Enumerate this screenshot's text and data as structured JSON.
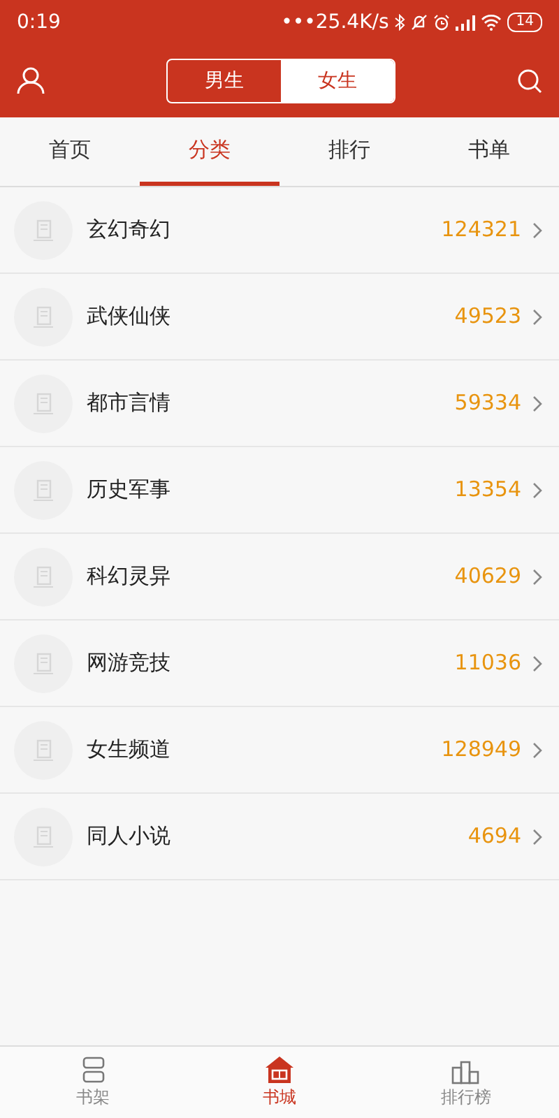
{
  "status_bar": {
    "time": "0:19",
    "network_speed": "•••25.4K/s",
    "battery": "14"
  },
  "header": {
    "segments": [
      {
        "label": "男生",
        "selected": false
      },
      {
        "label": "女生",
        "selected": true
      }
    ]
  },
  "tabs": [
    {
      "label": "首页",
      "selected": false
    },
    {
      "label": "分类",
      "selected": true
    },
    {
      "label": "排行",
      "selected": false
    },
    {
      "label": "书单",
      "selected": false
    }
  ],
  "categories": [
    {
      "name": "玄幻奇幻",
      "count": "124321"
    },
    {
      "name": "武侠仙侠",
      "count": "49523"
    },
    {
      "name": "都市言情",
      "count": "59334"
    },
    {
      "name": "历史军事",
      "count": "13354"
    },
    {
      "name": "科幻灵异",
      "count": "40629"
    },
    {
      "name": "网游竞技",
      "count": "11036"
    },
    {
      "name": "女生频道",
      "count": "128949"
    },
    {
      "name": "同人小说",
      "count": "4694"
    }
  ],
  "bottom_nav": [
    {
      "label": "书架",
      "kind": "shelf",
      "selected": false
    },
    {
      "label": "书城",
      "kind": "store",
      "selected": true
    },
    {
      "label": "排行榜",
      "kind": "rank",
      "selected": false
    }
  ]
}
